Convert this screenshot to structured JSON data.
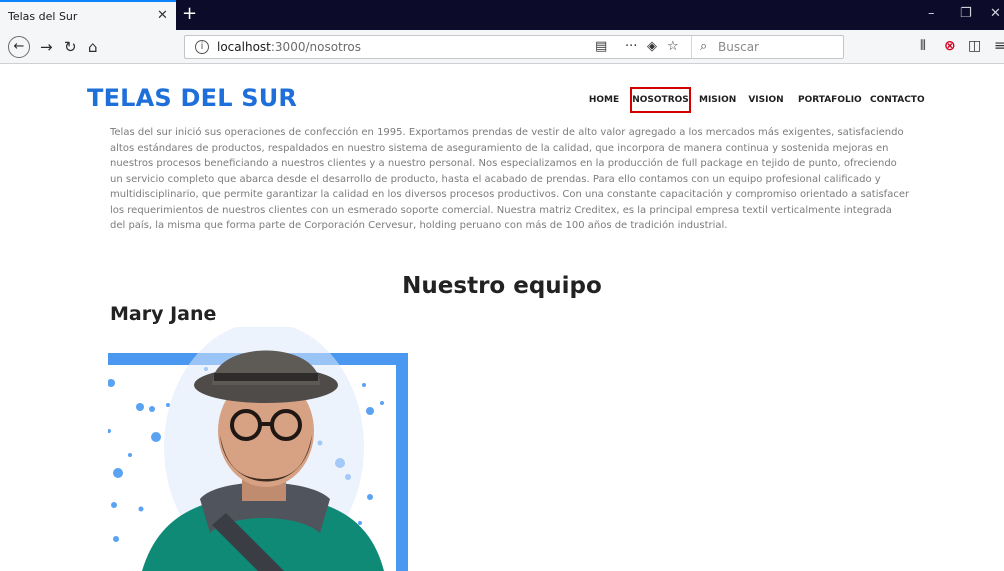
{
  "browser": {
    "tab_title": "Telas del Sur",
    "tab_close": "✕",
    "new_tab": "+",
    "url_host": "localhost",
    "url_path": ":3000/nosotros",
    "search_placeholder": "Buscar"
  },
  "site": {
    "brand": "TELAS DEL SUR",
    "menu": [
      "HOME",
      "NOSOTROS",
      "MISION",
      "VISION",
      "PORTAFOLIO",
      "CONTACTO"
    ],
    "active_menu": "NOSOTROS",
    "intro": "Telas del sur inició sus operaciones de confección en 1995. Exportamos prendas de vestir de alto valor agregado a los mercados más exigentes, satisfaciendo altos estándares de productos, respaldados en nuestro sistema de aseguramiento de la calidad, que incorpora de manera continua y sostenida mejoras en nuestros procesos beneficiando a nuestros clientes y a nuestro personal. Nos especializamos en la producción de full package en tejido de punto, ofreciendo un servicio completo que abarca desde el desarrollo de producto, hasta el acabado de prendas. Para ello contamos con un equipo profesional calificado y multidisciplinario, que permite garantizar la calidad en los diversos procesos productivos. Con una constante capacitación y compromiso orientado a satisfacer los requerimientos de nuestros clientes con un esmerado soporte comercial. Nuestra matriz Creditex, es la principal empresa textil verticalmente integrada del país, la misma que forma parte de Corporación Cervesur, holding peruano con más de 100 años de tradición industrial.",
    "team_title": "Nuestro equipo",
    "member_name": "Mary Jane"
  },
  "colors": {
    "brand": "#1e6fd9",
    "active_border": "#d40000",
    "photo_frame": "#3a8fee"
  }
}
